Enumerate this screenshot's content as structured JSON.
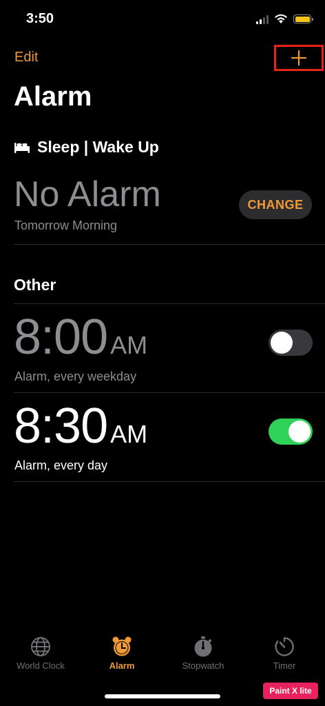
{
  "status_bar": {
    "time": "3:50",
    "icons": [
      "signal-icon",
      "wifi-icon",
      "battery-icon"
    ],
    "battery_color": "#f5c518"
  },
  "header": {
    "edit_label": "Edit",
    "add_icon": "plus-icon",
    "title": "Alarm"
  },
  "sleep_section": {
    "icon": "bed-icon",
    "title": "Sleep | Wake Up",
    "alarm_text": "No Alarm",
    "subtitle": "Tomorrow Morning",
    "change_label": "CHANGE"
  },
  "other_section": {
    "title": "Other",
    "alarms": [
      {
        "time": "8:00",
        "ampm": "AM",
        "label": "Alarm, every weekday",
        "enabled": false
      },
      {
        "time": "8:30",
        "ampm": "AM",
        "label": "Alarm, every day",
        "enabled": true
      }
    ]
  },
  "tab_bar": {
    "tabs": [
      {
        "label": "World Clock",
        "icon": "globe-icon",
        "active": false
      },
      {
        "label": "Alarm",
        "icon": "alarm-clock-icon",
        "active": true
      },
      {
        "label": "Stopwatch",
        "icon": "stopwatch-icon",
        "active": false
      },
      {
        "label": "Timer",
        "icon": "timer-icon",
        "active": false
      }
    ]
  },
  "watermark": {
    "text": "Paint X lite"
  },
  "colors": {
    "accent": "#f09a37",
    "toggle_on": "#30d158",
    "toggle_off": "#39393d",
    "highlight_box": "#e8231a"
  }
}
